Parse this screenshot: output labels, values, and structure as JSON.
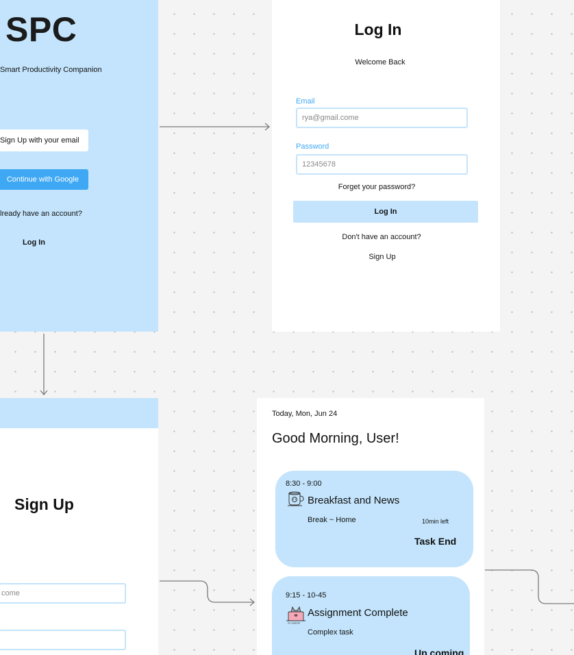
{
  "splash": {
    "logo": "SPC",
    "tagline": "Smart Productivity Companion",
    "signup_email_label": "Sign Up with your email",
    "google_label": "Continue with Google",
    "already_text": "lready have an account?",
    "login_link": "Log In"
  },
  "login": {
    "title": "Log In",
    "subtitle": "Welcome Back",
    "email_label": "Email",
    "email_value": "rya@gmail.come",
    "password_label": "Password",
    "password_value": "12345678",
    "forgot": "Forget your password?",
    "button": "Log In",
    "no_account": "Don't have an account?",
    "signup_link": "Sign Up"
  },
  "signup": {
    "title": "Sign Up",
    "email_value": "come",
    "password_value": ""
  },
  "dashboard": {
    "date": "Today, Mon, Jun 24",
    "greeting": "Good Morning, User!",
    "tasks": [
      {
        "time": "8:30 - 9:00",
        "title": "Breakfast and News",
        "subtitle": "Break ~ Home",
        "time_left": "10min left",
        "status": "Task End",
        "icon": "coffee-cup-icon"
      },
      {
        "time": "9:15 - 10-45",
        "title": "Assignment Complete",
        "subtitle": "Complex task",
        "status": "Up coming",
        "icon": "cat-laptop-icon"
      }
    ]
  },
  "colors": {
    "panel_blue": "#c3e4fc",
    "accent_blue": "#3fa8f4",
    "canvas": "#f4f4f4"
  }
}
